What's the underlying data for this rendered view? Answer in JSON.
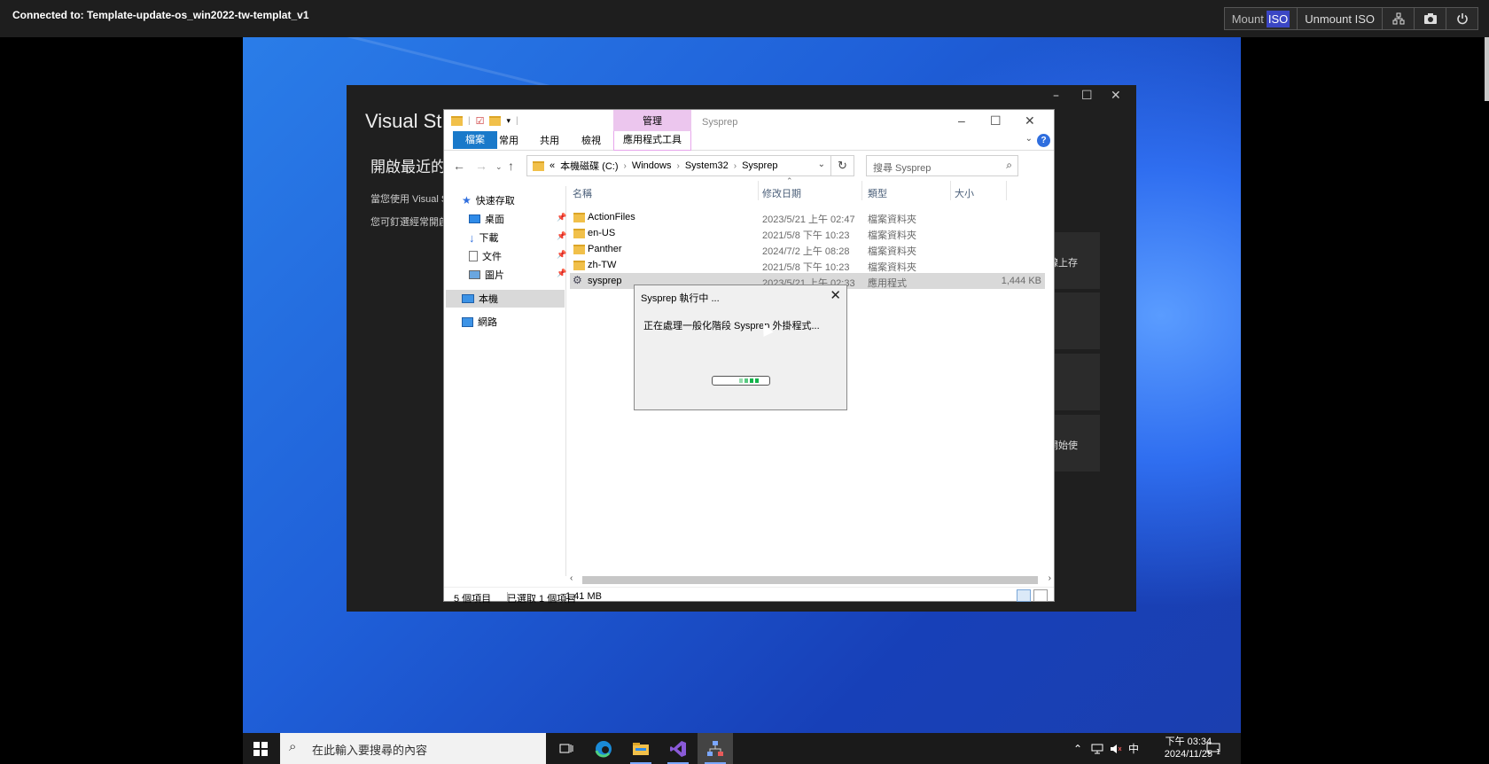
{
  "session": {
    "connected_label": "Connected to: Template-update-os_win2022-tw-templat_v1",
    "mount_label": "Mount",
    "mount_hl": "ISO",
    "unmount_label": "Unmount ISO"
  },
  "vs_window": {
    "title": "Visual St",
    "open_recent": "開啟最近的",
    "line1": "當您使用 Visual S",
    "line2": "您可釘選經常開啟",
    "card1": "線上存",
    "card4": "開始使"
  },
  "explorer": {
    "title": "Sysprep",
    "manage_tab": "管理",
    "ribbon": {
      "file": "檔案",
      "home": "常用",
      "share": "共用",
      "view": "檢視",
      "app_tools": "應用程式工具"
    },
    "address": {
      "prefix": "«",
      "parts": [
        "本機磁碟 (C:)",
        "Windows",
        "System32",
        "Sysprep"
      ]
    },
    "search_placeholder": "搜尋 Sysprep",
    "nav": {
      "quick_access": "快速存取",
      "desktop": "桌面",
      "downloads": "下載",
      "documents": "文件",
      "pictures": "圖片",
      "this_pc": "本機",
      "network": "網路"
    },
    "columns": {
      "name": "名稱",
      "date": "修改日期",
      "type": "類型",
      "size": "大小"
    },
    "rows": [
      {
        "name": "ActionFiles",
        "date": "2023/5/21 上午 02:47",
        "type": "檔案資料夾",
        "size": ""
      },
      {
        "name": "en-US",
        "date": "2021/5/8 下午 10:23",
        "type": "檔案資料夾",
        "size": ""
      },
      {
        "name": "Panther",
        "date": "2024/7/2 上午 08:28",
        "type": "檔案資料夾",
        "size": ""
      },
      {
        "name": "zh-TW",
        "date": "2021/5/8 下午 10:23",
        "type": "檔案資料夾",
        "size": ""
      },
      {
        "name": "sysprep",
        "date": "2023/5/21 上午 02:33",
        "type": "應用程式",
        "size": "1,444 KB"
      }
    ],
    "status": {
      "count": "5 個項目",
      "selected": "已選取 1 個項目",
      "size": "1.41 MB"
    }
  },
  "dialog": {
    "title": "Sysprep 執行中 ...",
    "message": "正在處理一般化階段 Sysprep 外掛程式..."
  },
  "taskbar": {
    "search_placeholder": "在此輸入要搜尋的內容",
    "ime": "中",
    "time": "下午 03:34",
    "date": "2024/11/25",
    "notif_count": "1"
  },
  "colors": {
    "accent": "#1979ca",
    "manage_tab": "#ecc6ee",
    "progress": "#12b34a"
  }
}
